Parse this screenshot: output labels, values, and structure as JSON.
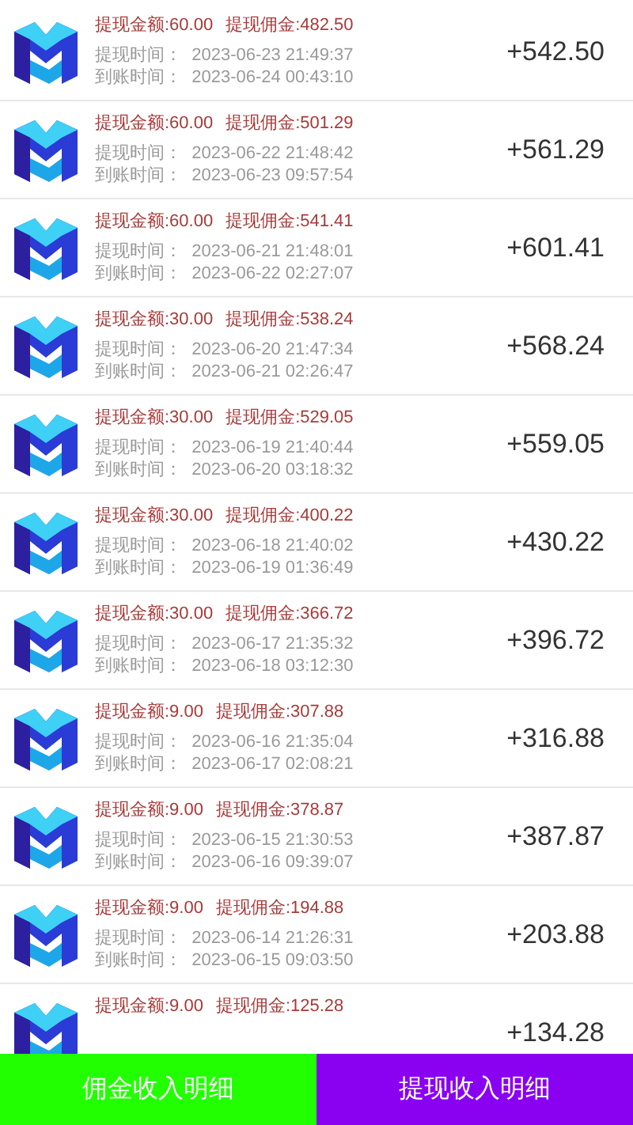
{
  "records": [
    {
      "amount_label": "提现金额:60.00",
      "commission_label": "提现佣金:482.50",
      "withdraw_time": "提现时间：  2023-06-23 21:49:37",
      "arrival_time": "到账时间：  2023-06-24 00:43:10",
      "total": "+542.50"
    },
    {
      "amount_label": "提现金额:60.00",
      "commission_label": "提现佣金:501.29",
      "withdraw_time": "提现时间：  2023-06-22 21:48:42",
      "arrival_time": "到账时间：  2023-06-23 09:57:54",
      "total": "+561.29"
    },
    {
      "amount_label": "提现金额:60.00",
      "commission_label": "提现佣金:541.41",
      "withdraw_time": "提现时间：  2023-06-21 21:48:01",
      "arrival_time": "到账时间：  2023-06-22 02:27:07",
      "total": "+601.41"
    },
    {
      "amount_label": "提现金额:30.00",
      "commission_label": "提现佣金:538.24",
      "withdraw_time": "提现时间：  2023-06-20 21:47:34",
      "arrival_time": "到账时间：  2023-06-21 02:26:47",
      "total": "+568.24"
    },
    {
      "amount_label": "提现金额:30.00",
      "commission_label": "提现佣金:529.05",
      "withdraw_time": "提现时间：  2023-06-19 21:40:44",
      "arrival_time": "到账时间：  2023-06-20 03:18:32",
      "total": "+559.05"
    },
    {
      "amount_label": "提现金额:30.00",
      "commission_label": "提现佣金:400.22",
      "withdraw_time": "提现时间：  2023-06-18 21:40:02",
      "arrival_time": "到账时间：  2023-06-19 01:36:49",
      "total": "+430.22"
    },
    {
      "amount_label": "提现金额:30.00",
      "commission_label": "提现佣金:366.72",
      "withdraw_time": "提现时间：  2023-06-17 21:35:32",
      "arrival_time": "到账时间：  2023-06-18 03:12:30",
      "total": "+396.72"
    },
    {
      "amount_label": "提现金额:9.00",
      "commission_label": "提现佣金:307.88",
      "withdraw_time": "提现时间：  2023-06-16 21:35:04",
      "arrival_time": "到账时间：  2023-06-17 02:08:21",
      "total": "+316.88"
    },
    {
      "amount_label": "提现金额:9.00",
      "commission_label": "提现佣金:378.87",
      "withdraw_time": "提现时间：  2023-06-15 21:30:53",
      "arrival_time": "到账时间：  2023-06-16 09:39:07",
      "total": "+387.87"
    },
    {
      "amount_label": "提现金额:9.00",
      "commission_label": "提现佣金:194.88",
      "withdraw_time": "提现时间：  2023-06-14 21:26:31",
      "arrival_time": "到账时间：  2023-06-15 09:03:50",
      "total": "+203.88"
    },
    {
      "amount_label": "提现金额:9.00",
      "commission_label": "提现佣金:125.28",
      "total": "+134.28"
    }
  ],
  "bottom_tabs": [
    {
      "label": "佣金收入明细",
      "color": "#22ff00"
    },
    {
      "label": "提现收入明细",
      "color": "#8a00f0"
    }
  ]
}
